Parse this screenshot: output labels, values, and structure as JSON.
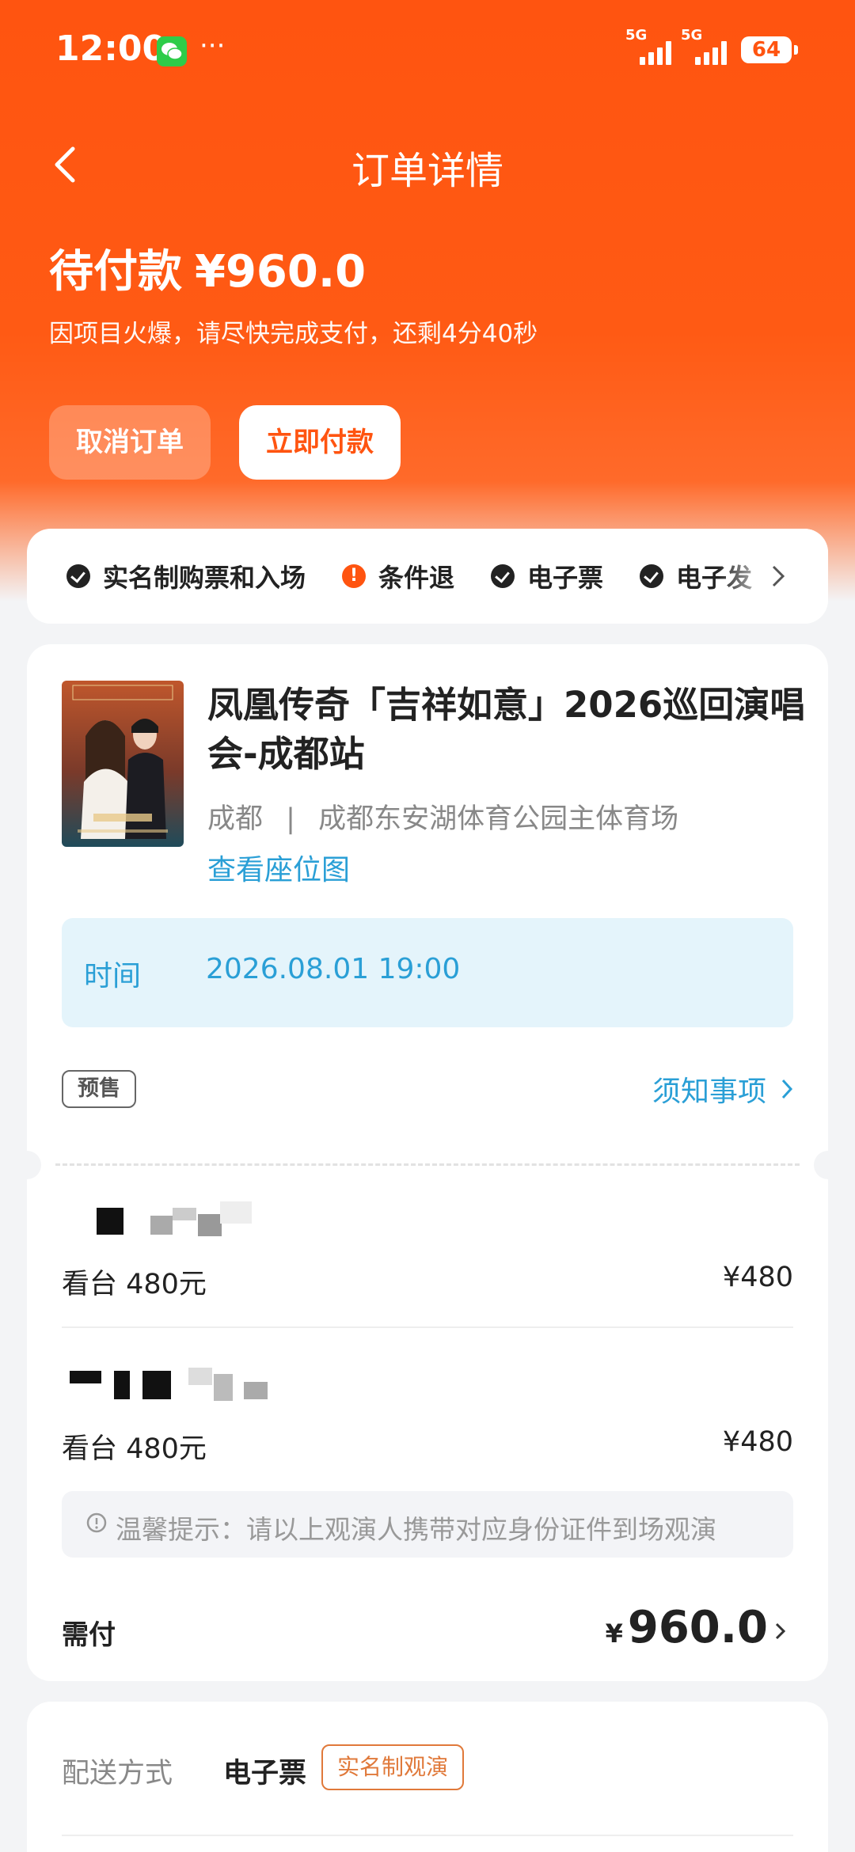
{
  "status_bar": {
    "time": "12:00",
    "more": "···",
    "network_1": "5G",
    "network_2": "5G",
    "battery": "64"
  },
  "header": {
    "title": "订单详情",
    "order_status": "待付款",
    "amount": "¥960.0",
    "countdown_tip": "因项目火爆，请尽快完成支付，还剩4分40秒",
    "cancel_label": "取消订单",
    "pay_label": "立即付款"
  },
  "tags": [
    {
      "label": "实名制购票和入场",
      "icon": "check-circle-icon"
    },
    {
      "label": "条件退",
      "icon": "warning-circle-icon"
    },
    {
      "label": "电子票",
      "icon": "check-circle-icon"
    },
    {
      "label": "电子发",
      "icon": "check-circle-icon"
    }
  ],
  "event": {
    "title": "凤凰传奇「吉祥如意」2026巡回演唱会-成都站",
    "city": "成都",
    "separator": "|",
    "venue": "成都东安湖体育公园主体育场",
    "seat_map_link": "查看座位图",
    "time_label": "时间",
    "time_value": "2026.08.01 19:00",
    "presale_badge": "预售",
    "notice_link": "须知事项"
  },
  "tickets": [
    {
      "label": "看台 480元",
      "price": "¥480"
    },
    {
      "label": "看台 480元",
      "price": "¥480"
    }
  ],
  "tip": "温馨提示：请以上观演人携带对应身份证件到场观演",
  "total": {
    "label": "需付",
    "currency": "¥",
    "amount": "960.0"
  },
  "delivery": {
    "label": "配送方式",
    "value": "电子票",
    "badge": "实名制观演"
  },
  "colors": {
    "brand": "#ff5410",
    "link": "#2a9fd6",
    "badge_orange": "#e0793a"
  }
}
